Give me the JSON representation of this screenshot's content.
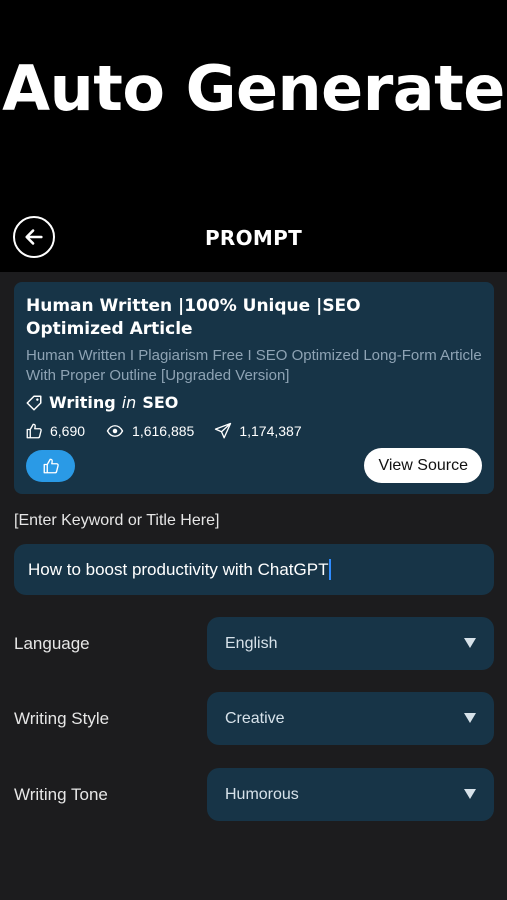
{
  "hero": {
    "title": "Auto Generate"
  },
  "nav": {
    "title": "PROMPT"
  },
  "card": {
    "title": "Human Written |100% Unique |SEO Optimized Article",
    "description": "Human Written I Plagiarism Free I SEO Optimized Long-Form Article With Proper Outline [Upgraded Version]",
    "category_prefix": "Writing",
    "category_in": "in",
    "category": "SEO",
    "stats": {
      "likes": "6,690",
      "views": "1,616,885",
      "shares": "1,174,387"
    },
    "view_source_label": "View Source"
  },
  "prompt": {
    "label": "[Enter Keyword or Title Here]",
    "value": "How to boost productivity with ChatGPT"
  },
  "options": [
    {
      "label": "Language",
      "value": "English"
    },
    {
      "label": "Writing Style",
      "value": "Creative"
    },
    {
      "label": "Writing Tone",
      "value": "Humorous"
    }
  ],
  "colors": {
    "card_bg": "#173447",
    "accent": "#2a9ae6",
    "page_bg": "#1c1c1e"
  },
  "icons": [
    "arrow-left-icon",
    "tag-icon",
    "thumbs-up-icon",
    "eye-icon",
    "send-icon",
    "triangle-down-icon"
  ]
}
